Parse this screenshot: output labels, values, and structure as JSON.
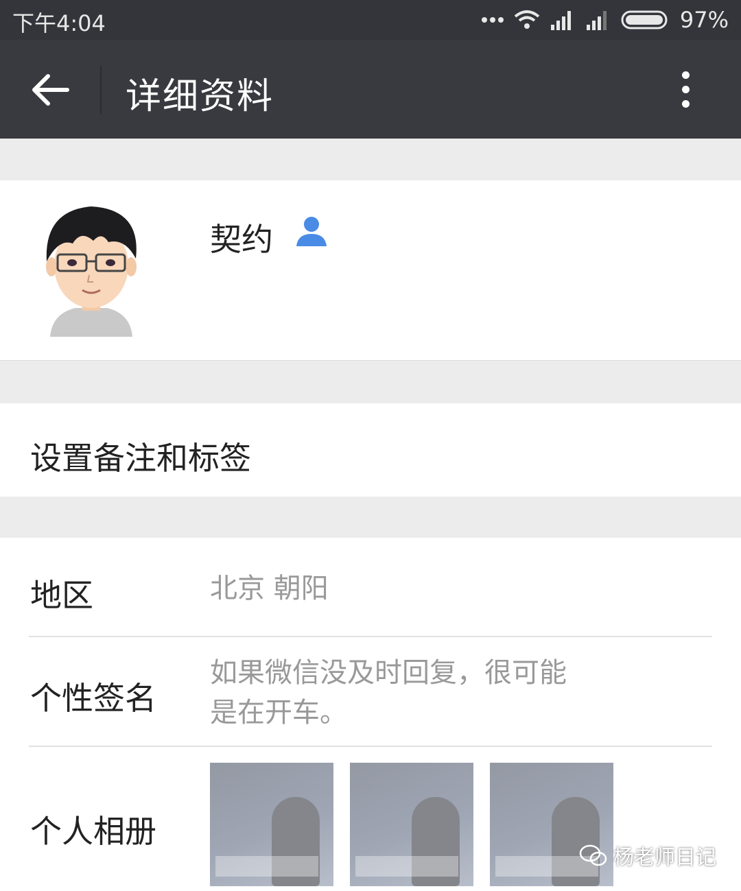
{
  "status_bar": {
    "time": "下午4:04",
    "battery": "97%"
  },
  "nav": {
    "title": "详细资料"
  },
  "profile": {
    "name": "契约"
  },
  "remark": {
    "label": "设置备注和标签"
  },
  "region": {
    "label": "地区",
    "value": "北京  朝阳"
  },
  "signature": {
    "label": "个性签名",
    "line1": "如果微信没及时回复，很可能",
    "line2": "是在开车。"
  },
  "album": {
    "label": "个人相册"
  },
  "watermark": {
    "text": "杨老师日记"
  }
}
